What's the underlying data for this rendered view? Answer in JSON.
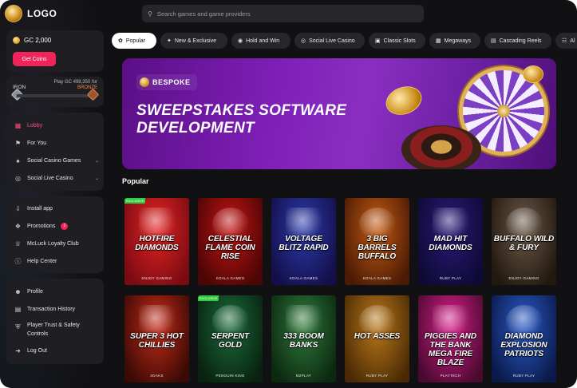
{
  "logo": "LOGO",
  "search": {
    "placeholder": "Search games and game providers"
  },
  "wallet": {
    "balance": "GC 2,000",
    "cta": "Get Coins"
  },
  "tier": {
    "current": "IRON",
    "play_text": "Play GC 498,350 for",
    "next": "BRONZE",
    "progress": 0.01
  },
  "nav_main": [
    {
      "label": "Lobby",
      "icon": "lobby-icon"
    },
    {
      "label": "For You",
      "icon": "bookmark-icon"
    },
    {
      "label": "Social Casino Games",
      "icon": "spade-icon"
    },
    {
      "label": "Social Live Casino",
      "icon": "live-icon"
    }
  ],
  "nav_secondary": [
    {
      "label": "Install app",
      "icon": "download-icon"
    },
    {
      "label": "Promotions",
      "icon": "gift-icon",
      "badge": "1"
    },
    {
      "label": "McLuck Loyalty Club",
      "icon": "crown-icon"
    },
    {
      "label": "Help Center",
      "icon": "help-icon"
    }
  ],
  "nav_account": [
    {
      "label": "Profile",
      "icon": "user-icon"
    },
    {
      "label": "Transaction History",
      "icon": "history-icon"
    },
    {
      "label": "Player Trust & Safety Controls",
      "icon": "shield-icon"
    },
    {
      "label": "Log Out",
      "icon": "logout-icon"
    }
  ],
  "chips": [
    {
      "label": "Popular",
      "icon": "fire-icon"
    },
    {
      "label": "New & Exclusive",
      "icon": "sparkle-icon"
    },
    {
      "label": "Hold and Win",
      "icon": "coin-icon"
    },
    {
      "label": "Social Live Casino",
      "icon": "live-icon"
    },
    {
      "label": "Classic Slots",
      "icon": "slot-icon"
    },
    {
      "label": "Megaways",
      "icon": "grid-icon"
    },
    {
      "label": "Cascading Reels",
      "icon": "reels-icon"
    },
    {
      "label": "Al",
      "icon": "all-icon"
    }
  ],
  "banner": {
    "tag": "BESPOKE",
    "title": "SWEEPSTAKES SOFTWARE DEVELOPMENT"
  },
  "section_title": "Popular",
  "games": [
    {
      "title": "HOTFIRE DIAMONDS",
      "provider": "ENJOY GAMING",
      "badge": "EXCLUSIVE",
      "bg": "#e32322",
      "bg2": "#7a0b12"
    },
    {
      "title": "CELESTIAL FLAME COIN RISE",
      "provider": "KOALA GAMES",
      "badge": "",
      "bg": "#c41414",
      "bg2": "#4a0505"
    },
    {
      "title": "VOLTAGE BLITZ RAPID",
      "provider": "KOALA GAMES",
      "badge": "",
      "bg": "#2b3aa8",
      "bg2": "#140f4a"
    },
    {
      "title": "3 BIG BARRELS BUFFALO",
      "provider": "KOALA GAMES",
      "badge": "",
      "bg": "#c25a12",
      "bg2": "#4a1a05"
    },
    {
      "title": "MAD HIT DIAMONDS",
      "provider": "RUBY PLAY",
      "badge": "",
      "bg": "#2a1a78",
      "bg2": "#0e0a35"
    },
    {
      "title": "BUFFALO WILD & FURY",
      "provider": "ENJOY GAMING",
      "badge": "",
      "bg": "#6a5a48",
      "bg2": "#22180f"
    },
    {
      "title": "SUPER 3 HOT CHILLIES",
      "provider": "3OAKS",
      "badge": "",
      "bg": "#c42a18",
      "bg2": "#3a0a05"
    },
    {
      "title": "SERPENT GOLD",
      "provider": "PENGUIN KING",
      "badge": "EXCLUSIVE",
      "bg": "#1a6a3a",
      "bg2": "#08220f"
    },
    {
      "title": "333 BOOM BANKS",
      "provider": "M2PLAY",
      "badge": "",
      "bg": "#2e7a3a",
      "bg2": "#0c2810"
    },
    {
      "title": "HOT ASSES",
      "provider": "RUBY PLAY",
      "badge": "",
      "bg": "#b8781a",
      "bg2": "#4a2a05"
    },
    {
      "title": "PIGGIES AND THE BANK MEGA FIRE BLAZE",
      "provider": "PLAYTECH",
      "badge": "",
      "bg": "#d81e8a",
      "bg2": "#4a0a30"
    },
    {
      "title": "DIAMOND EXPLOSION PATRIOTS",
      "provider": "RUBY PLAY",
      "badge": "",
      "bg": "#2a5ac8",
      "bg2": "#0a1a4a"
    }
  ]
}
